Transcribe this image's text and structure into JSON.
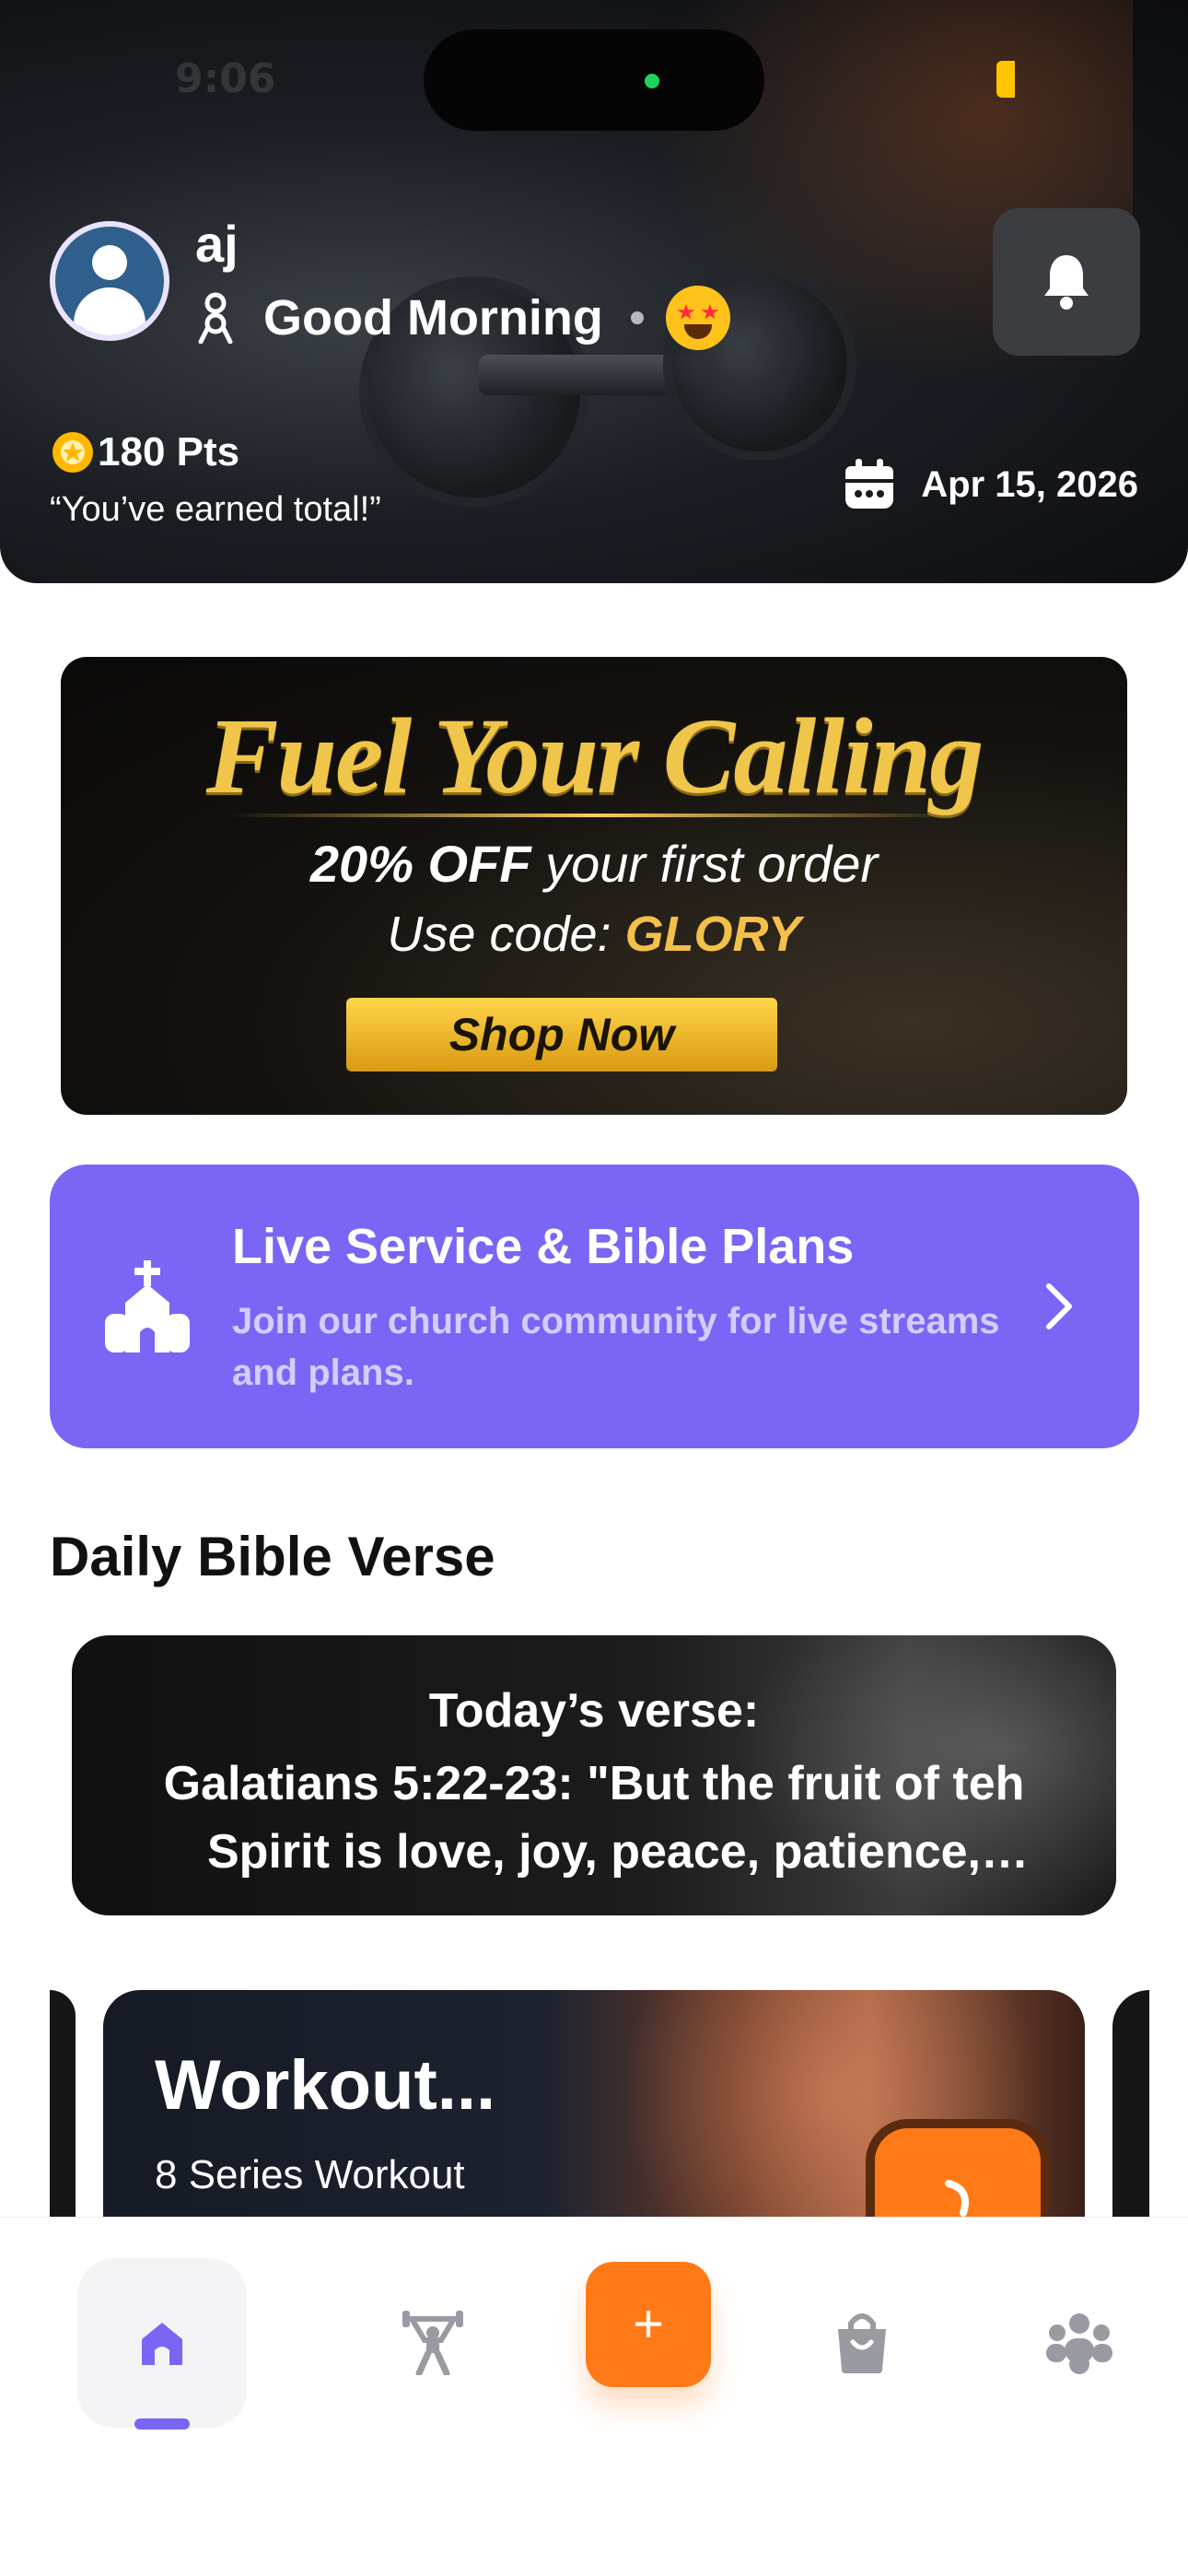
{
  "status_bar": {
    "time": "9:06"
  },
  "header": {
    "user_name": "aj",
    "greeting": "Good Morning",
    "points": "180 Pts",
    "points_caption": "“You’ve earned total!”",
    "date": "Apr 15, 2026",
    "icons": {
      "avatar": "user-avatar",
      "greeting": "ribbon-icon",
      "emoji": "star-struck-emoji",
      "notification": "bell-icon",
      "points": "star-badge-icon",
      "date": "calendar-icon"
    }
  },
  "promo": {
    "title": "Fuel Your Calling",
    "discount": "20% OFF",
    "discount_rest": "your first order",
    "code_label": "Use code:",
    "code": "GLORY",
    "cta": "Shop Now"
  },
  "live_service": {
    "title": "Live Service & Bible Plans",
    "description": "Join our church community for live streams and plans.",
    "icon": "church-icon",
    "accent": "#7a66f5"
  },
  "daily_verse": {
    "section_title": "Daily Bible Verse",
    "heading": "Today’s verse:",
    "text": "Galatians 5:22-23: \"But the fruit of teh Spirit is love, joy, peace, patience, kindness, goodness, faithfulness\""
  },
  "workout": {
    "title": "Workout...",
    "subtitle": "8 Series Workout",
    "button_color": "#ff7a17"
  },
  "bottom_nav": {
    "items": [
      {
        "icon": "home-icon",
        "active": true
      },
      {
        "icon": "weightlifting-icon",
        "active": false
      },
      {
        "icon": "plus-icon",
        "active": false
      },
      {
        "icon": "shopping-bag-icon",
        "active": false
      },
      {
        "icon": "community-icon",
        "active": false
      }
    ],
    "add_label": "+",
    "active_color": "#7a66f5",
    "accent": "#ff7a17"
  }
}
